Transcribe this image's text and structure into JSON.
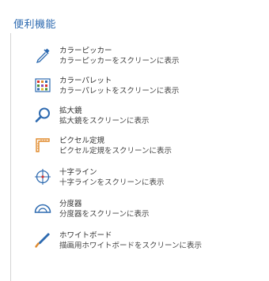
{
  "section": {
    "title": "便利機能"
  },
  "items": [
    {
      "icon": "eyedropper-icon",
      "title": "カラーピッカー",
      "desc": "カラーピッカーをスクリーンに表示"
    },
    {
      "icon": "color-palette-icon",
      "title": "カラーパレット",
      "desc": "カラーパレットをスクリーンに表示"
    },
    {
      "icon": "magnifier-icon",
      "title": "拡大鏡",
      "desc": "拡大鏡をスクリーンに表示"
    },
    {
      "icon": "pixel-ruler-icon",
      "title": "ピクセル定規",
      "desc": "ピクセル定規をスクリーンに表示"
    },
    {
      "icon": "crosshair-icon",
      "title": "十字ライン",
      "desc": "十字ラインをスクリーンに表示"
    },
    {
      "icon": "protractor-icon",
      "title": "分度器",
      "desc": "分度器をスクリーンに表示"
    },
    {
      "icon": "whiteboard-pen-icon",
      "title": "ホワイトボード",
      "desc": "描画用ホワイトボードをスクリーンに表示"
    }
  ],
  "colors": {
    "accent": "#2d6ab0",
    "ruler": "#e08a2c",
    "crosshair_center": "#d9322b"
  }
}
